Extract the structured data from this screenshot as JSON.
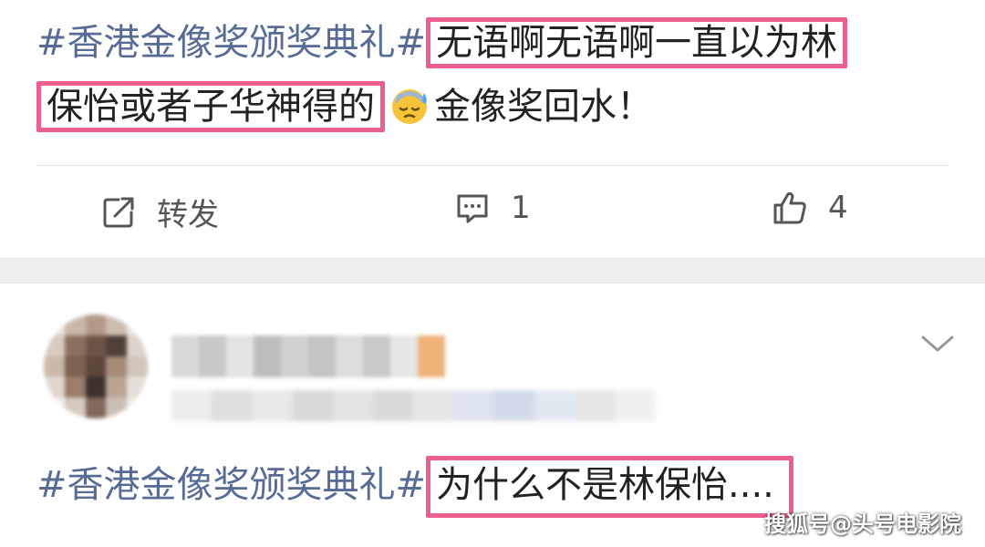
{
  "post1": {
    "hashtag": "#香港金像奖颁奖典礼#",
    "highlight_line1": "无语啊无语啊一直以为林",
    "highlight_line2": "保怡或者子华神得的",
    "emoji": "sweat-emoji",
    "tail": "金像奖回水！"
  },
  "actions": {
    "repost_label": "转发",
    "comment_count": "1",
    "like_count": "4"
  },
  "post2": {
    "hashtag": "#香港金像奖颁奖典礼#",
    "highlight": "为什么不是林保怡...."
  },
  "watermark": "搜狐号@头号电影院",
  "colors": {
    "hashtag": "#576b95",
    "highlight_border": "#ec5f8a",
    "separator": "#efefef"
  }
}
